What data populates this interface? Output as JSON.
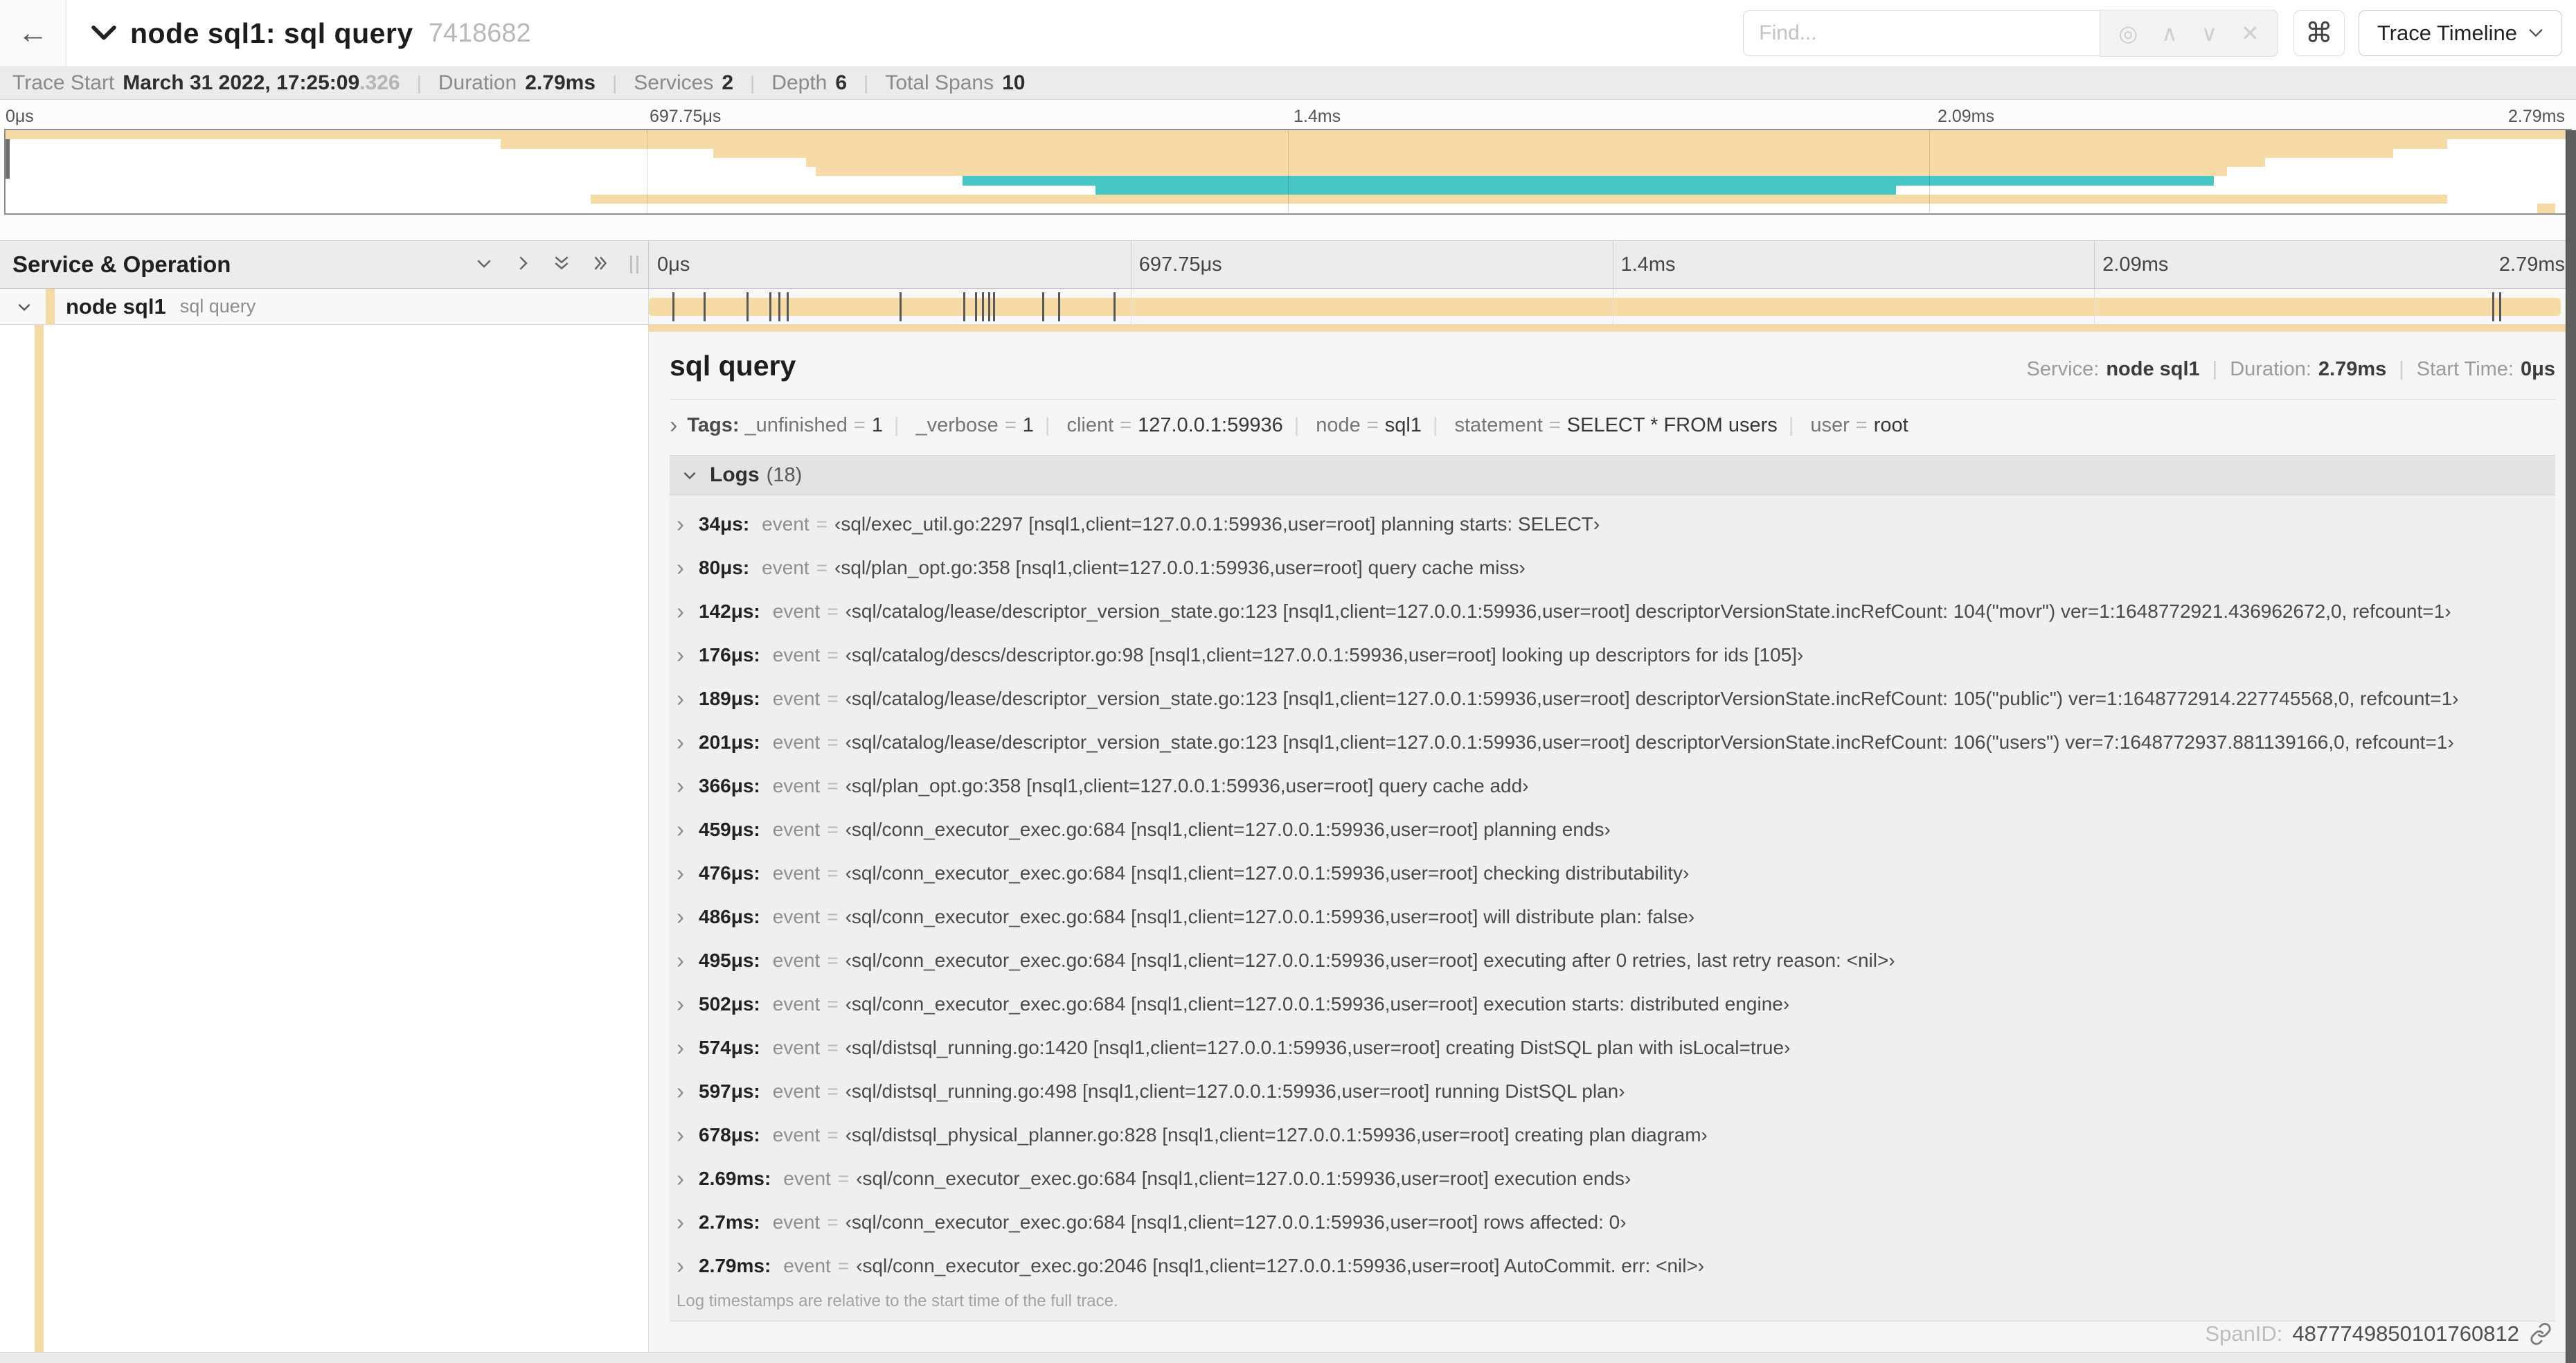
{
  "icons": {
    "back": "←",
    "target": "◎",
    "up": "∧",
    "down": "∨",
    "close": "✕",
    "cmd": "⌘",
    "tag_expand": "›",
    "row_expand": "›"
  },
  "colors": {
    "tan": "#f6dba6",
    "teal": "#48c5c5"
  },
  "header": {
    "title": "node sql1: sql query",
    "trace_id": "7418682",
    "find_placeholder": "Find...",
    "view_selector": "Trace Timeline"
  },
  "trace_info": {
    "items": [
      {
        "label": "Trace Start",
        "value": "March 31 2022, 17:25:09",
        "suffix": ".326"
      },
      {
        "label": "Duration",
        "value": "2.79ms"
      },
      {
        "label": "Services",
        "value": "2"
      },
      {
        "label": "Depth",
        "value": "6"
      },
      {
        "label": "Total Spans",
        "value": "10"
      }
    ]
  },
  "timeline": {
    "duration_us": 2790,
    "ticks": [
      {
        "label": "0μs",
        "pct": 0
      },
      {
        "label": "697.75μs",
        "pct": 25
      },
      {
        "label": "1.4ms",
        "pct": 50
      },
      {
        "label": "2.09ms",
        "pct": 75
      },
      {
        "label": "2.79ms",
        "pct": 100
      }
    ]
  },
  "minimap": {
    "rows": [
      {
        "start": 0,
        "end": 100,
        "color": "tan"
      },
      {
        "start": 19.3,
        "end": 95.2,
        "color": "tan"
      },
      {
        "start": 27.6,
        "end": 93.1,
        "color": "tan"
      },
      {
        "start": 31.2,
        "end": 88.1,
        "color": "tan"
      },
      {
        "start": 31.6,
        "end": 86.6,
        "color": "tan"
      },
      {
        "start": 37.3,
        "end": 86.1,
        "color": "teal"
      },
      {
        "start": 42.5,
        "end": 73.7,
        "color": "teal"
      },
      {
        "start": 22.8,
        "end": 95.2,
        "color": "tan"
      },
      {
        "start": 98.7,
        "end": 99.4,
        "color": "tan"
      }
    ]
  },
  "span_list": {
    "header": "Service & Operation",
    "row": {
      "service": "node sql1",
      "operation": "sql query"
    }
  },
  "detail": {
    "title": "sql query",
    "meta": [
      {
        "label": "Service:",
        "value": "node sql1"
      },
      {
        "label": "Duration:",
        "value": "2.79ms"
      },
      {
        "label": "Start Time:",
        "value": "0μs"
      }
    ],
    "tags_label": "Tags:",
    "tags": [
      {
        "key": "_unfinished",
        "value": "1"
      },
      {
        "key": "_verbose",
        "value": "1"
      },
      {
        "key": "client",
        "value": "127.0.0.1:59936"
      },
      {
        "key": "node",
        "value": "sql1"
      },
      {
        "key": "statement",
        "value": "SELECT * FROM users"
      },
      {
        "key": "user",
        "value": "root"
      }
    ],
    "logs_label": "Logs",
    "logs_count": "(18)",
    "log_field": "event",
    "logs": [
      {
        "us": 34,
        "t": "34μs:",
        "v": "‹sql/exec_util.go:2297 [nsql1,client=127.0.0.1:59936,user=root] planning starts: SELECT›"
      },
      {
        "us": 80,
        "t": "80μs:",
        "v": "‹sql/plan_opt.go:358 [nsql1,client=127.0.0.1:59936,user=root] query cache miss›"
      },
      {
        "us": 142,
        "t": "142μs:",
        "v": "‹sql/catalog/lease/descriptor_version_state.go:123 [nsql1,client=127.0.0.1:59936,user=root] descriptorVersionState.incRefCount: 104(\"movr\") ver=1:1648772921.436962672,0, refcount=1›"
      },
      {
        "us": 176,
        "t": "176μs:",
        "v": "‹sql/catalog/descs/descriptor.go:98 [nsql1,client=127.0.0.1:59936,user=root] looking up descriptors for ids [105]›"
      },
      {
        "us": 189,
        "t": "189μs:",
        "v": "‹sql/catalog/lease/descriptor_version_state.go:123 [nsql1,client=127.0.0.1:59936,user=root] descriptorVersionState.incRefCount: 105(\"public\") ver=1:1648772914.227745568,0, refcount=1›"
      },
      {
        "us": 201,
        "t": "201μs:",
        "v": "‹sql/catalog/lease/descriptor_version_state.go:123 [nsql1,client=127.0.0.1:59936,user=root] descriptorVersionState.incRefCount: 106(\"users\") ver=7:1648772937.881139166,0, refcount=1›"
      },
      {
        "us": 366,
        "t": "366μs:",
        "v": "‹sql/plan_opt.go:358 [nsql1,client=127.0.0.1:59936,user=root] query cache add›"
      },
      {
        "us": 459,
        "t": "459μs:",
        "v": "‹sql/conn_executor_exec.go:684 [nsql1,client=127.0.0.1:59936,user=root] planning ends›"
      },
      {
        "us": 476,
        "t": "476μs:",
        "v": "‹sql/conn_executor_exec.go:684 [nsql1,client=127.0.0.1:59936,user=root] checking distributability›"
      },
      {
        "us": 486,
        "t": "486μs:",
        "v": "‹sql/conn_executor_exec.go:684 [nsql1,client=127.0.0.1:59936,user=root] will distribute plan: false›"
      },
      {
        "us": 495,
        "t": "495μs:",
        "v": "‹sql/conn_executor_exec.go:684 [nsql1,client=127.0.0.1:59936,user=root] executing after 0 retries, last retry reason: <nil>›"
      },
      {
        "us": 502,
        "t": "502μs:",
        "v": "‹sql/conn_executor_exec.go:684 [nsql1,client=127.0.0.1:59936,user=root] execution starts: distributed engine›"
      },
      {
        "us": 574,
        "t": "574μs:",
        "v": "‹sql/distsql_running.go:1420 [nsql1,client=127.0.0.1:59936,user=root] creating DistSQL plan with isLocal=true›"
      },
      {
        "us": 597,
        "t": "597μs:",
        "v": "‹sql/distsql_running.go:498 [nsql1,client=127.0.0.1:59936,user=root] running DistSQL plan›"
      },
      {
        "us": 678,
        "t": "678μs:",
        "v": "‹sql/distsql_physical_planner.go:828 [nsql1,client=127.0.0.1:59936,user=root] creating plan diagram›"
      },
      {
        "us": 2690,
        "t": "2.69ms:",
        "v": "‹sql/conn_executor_exec.go:684 [nsql1,client=127.0.0.1:59936,user=root] execution ends›"
      },
      {
        "us": 2700,
        "t": "2.7ms:",
        "v": "‹sql/conn_executor_exec.go:684 [nsql1,client=127.0.0.1:59936,user=root] rows affected: 0›"
      },
      {
        "us": 2790,
        "t": "2.79ms:",
        "v": "‹sql/conn_executor_exec.go:2046 [nsql1,client=127.0.0.1:59936,user=root] AutoCommit. err: <nil>›"
      }
    ],
    "footer": "Log timestamps are relative to the start time of the full trace.",
    "span_id_label": "SpanID:",
    "span_id": "4877749850101760812"
  }
}
